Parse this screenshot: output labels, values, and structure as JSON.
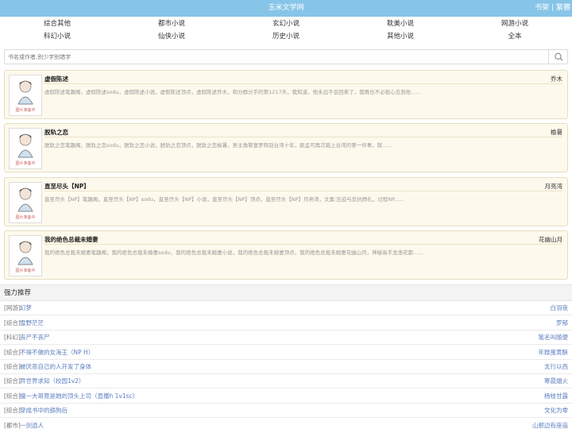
{
  "header": {
    "title": "玉米文学网",
    "bookshelf": "书架",
    "separator": "|",
    "traditional": "繁體"
  },
  "nav": {
    "row1": [
      "综合其他",
      "都市小说",
      "玄幻小说",
      "耽美小说",
      "网游小说"
    ],
    "row2": [
      "科幻小说",
      "仙侠小说",
      "历史小说",
      "其他小说",
      "全本"
    ]
  },
  "search": {
    "placeholder": "书名或作者,别少字别错字",
    "icon": "search-icon"
  },
  "books": [
    {
      "title": "虚假陈述",
      "author": "乔木",
      "desc": "虚假陈述笔趣阁，虚假陈述sodu，虚假陈述小说，虚假陈述顶点，虚假陈述乔木，和分群分手的第1217天，我知道，他永远不会回来了，我再也不必担心见到他......",
      "cover_text": "图片准备中"
    },
    {
      "title": "脱轨之恋",
      "author": "榆暑",
      "desc": "脱轨之恋笔趣阁，脱轨之恋sodu，脱轨之恋小说，脱轨之恋顶点，脱轨之恋榆暑，男主角黎富罗阵别台湾十年，颜孟可再次踏上台湾的第一件事，就......",
      "cover_text": "图片准备中"
    },
    {
      "title": "直至尽头【NP】",
      "author": "月亮湾",
      "desc": "直至尽头【NP】笔趣阁，直至尽头【NP】sodu，直至尽头【NP】小说，直至尽头【NP】顶点，直至尽头【NP】月亮湾，文案:压迫与反抗挣扎，过程NP......",
      "cover_text": "图片准备中"
    },
    {
      "title": "我的绝色总裁未婚妻",
      "author": "花幽山月",
      "desc": "我的绝色总裁未婚妻笔趣阁，我的绝色总裁未婚妻sodu，我的绝色总裁未婚妻小说，我的绝色总裁未婚妻顶点，我的绝色总裁未婚妻花幽山月，神秘高手龙渔花都......",
      "cover_text": "图片准备中"
    }
  ],
  "recommend": {
    "heading": "强力推荐",
    "items": [
      {
        "cat": "[网游]",
        "title": "幻梦",
        "author": "白羽夜"
      },
      {
        "cat": "[综合]",
        "title": "雪野茫茫",
        "author": "罗郁"
      },
      {
        "cat": "[科幻]",
        "title": "丧尸不丧尸",
        "author": "笔名叫随便"
      },
      {
        "cat": "[综合]",
        "title": "不得不做的女海王（NP H）",
        "author": "年糕蛋黄酥"
      },
      {
        "cat": "[综合]",
        "title": "被厌恶自己的人开发了身体",
        "author": "太行以西"
      },
      {
        "cat": "[综合]",
        "title": "异世界求知（校园1v2）",
        "author": "寒晨烟火"
      },
      {
        "cat": "[综合]",
        "title": "檀一大哥竟是她的顶头上司（直播h 1v1sc）",
        "author": "杨枝甘露"
      },
      {
        "cat": "[综合]",
        "title": "穿成书中的舔狗后",
        "author": "文化为零"
      },
      {
        "cat": "[都市]",
        "title": "一剑逍人",
        "author": "山那边有座庙"
      }
    ]
  }
}
